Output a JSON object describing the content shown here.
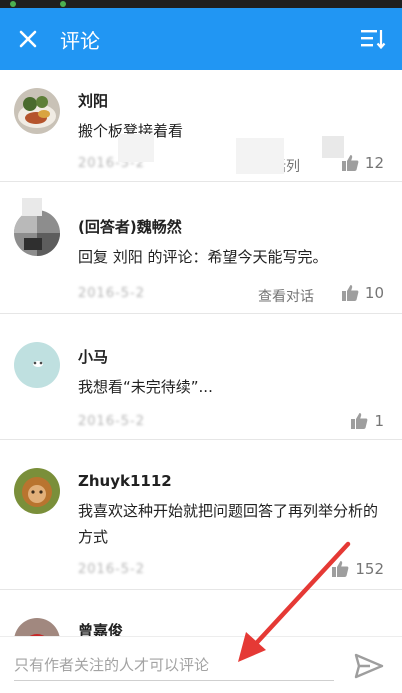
{
  "header": {
    "title": "评论"
  },
  "comments": [
    {
      "name": "刘阳",
      "text": "搬个板凳接着看",
      "date": "2016-5-2",
      "reply_label": "对话列",
      "likes": "12"
    },
    {
      "name": "(回答者)魏畅然",
      "text": "回复 刘阳 的评论：希望今天能写完。",
      "date": "2016-5-2",
      "reply_label": "查看对话",
      "likes": "10"
    },
    {
      "name": "小马",
      "text": "我想看“未完待续”...",
      "date": "2016-5-2",
      "likes": "1"
    },
    {
      "name": "Zhuyk1112",
      "text": "我喜欢这种开始就把问题回答了再列举分析的方式",
      "date": "2016-5-2",
      "likes": "152"
    },
    {
      "name": "曾嘉俊"
    }
  ],
  "input": {
    "placeholder": "只有作者关注的人才可以评论"
  },
  "icons": {
    "close": "close-icon",
    "sort": "sort-icon",
    "like": "thumbs-up-icon",
    "send": "send-icon"
  },
  "colors": {
    "appbar": "#2196f3",
    "arrow": "#e53935"
  }
}
